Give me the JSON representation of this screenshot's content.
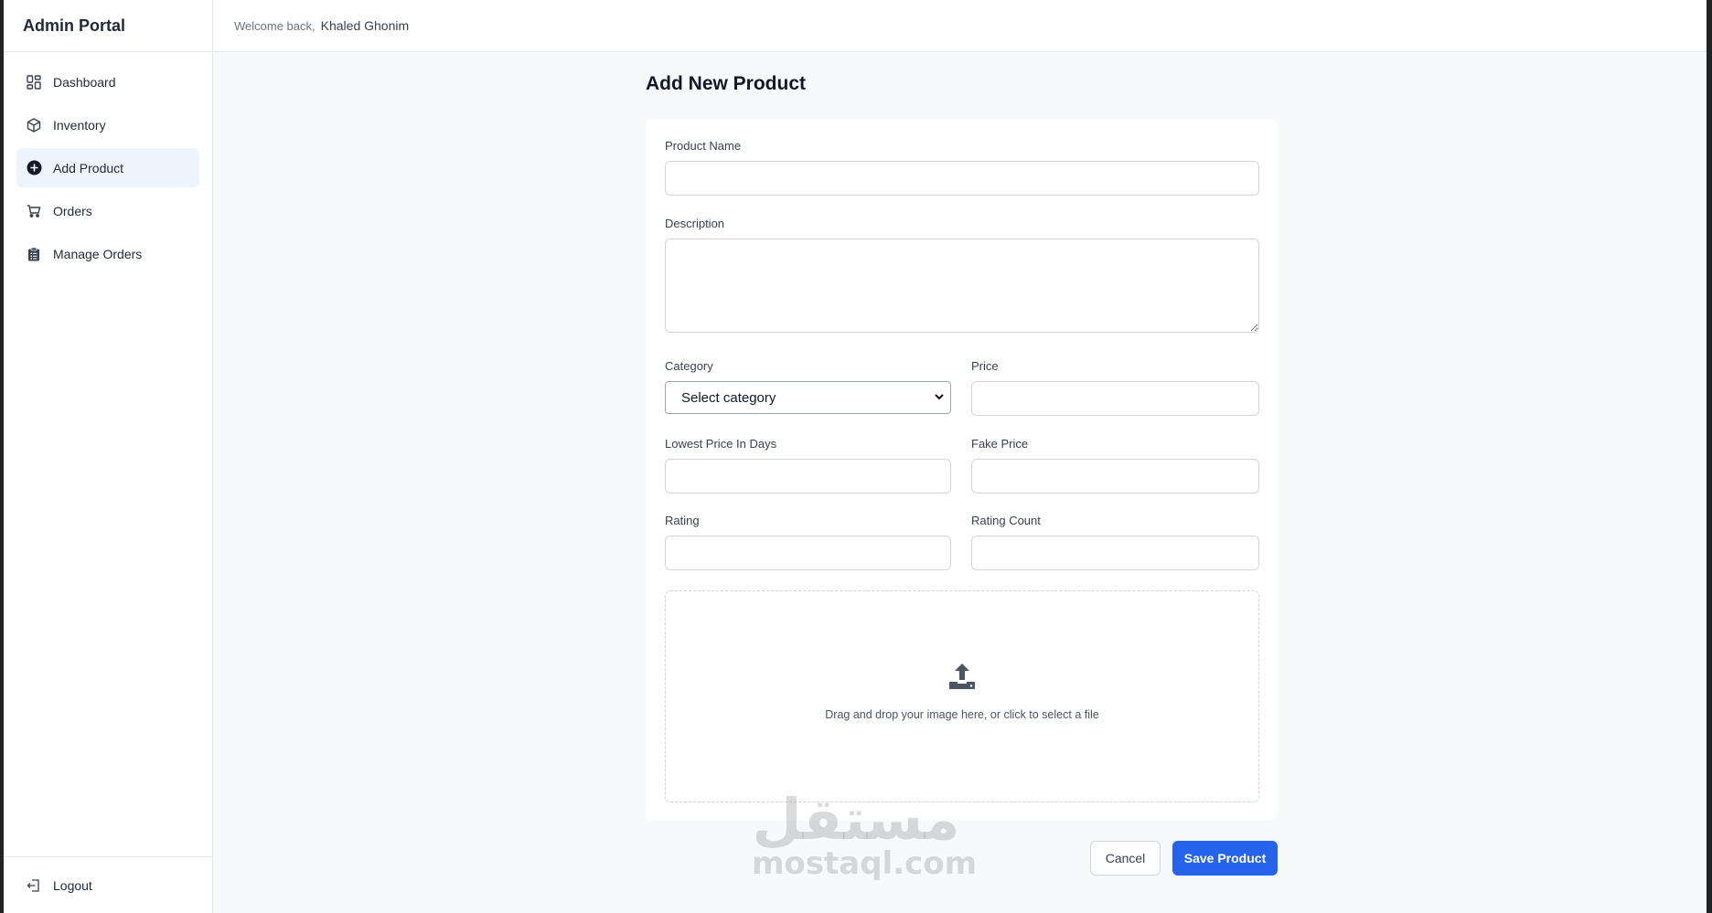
{
  "brand": "Admin Portal",
  "header": {
    "welcome": "Welcome back,",
    "username": "Khaled Ghonim"
  },
  "sidebar": {
    "items": [
      {
        "label": "Dashboard",
        "icon": "dashboard-icon",
        "active": false
      },
      {
        "label": "Inventory",
        "icon": "box-icon",
        "active": false
      },
      {
        "label": "Add Product",
        "icon": "plus-circle-icon",
        "active": true
      },
      {
        "label": "Orders",
        "icon": "cart-icon",
        "active": false
      },
      {
        "label": "Manage Orders",
        "icon": "clipboard-icon",
        "active": false
      }
    ],
    "logout": "Logout"
  },
  "page_title": "Add New Product",
  "form": {
    "product_name": {
      "label": "Product Name",
      "value": ""
    },
    "description": {
      "label": "Description",
      "value": ""
    },
    "category": {
      "label": "Category",
      "selected": "Select category"
    },
    "price": {
      "label": "Price",
      "value": ""
    },
    "lowest_price_days": {
      "label": "Lowest Price In Days",
      "value": ""
    },
    "fake_price": {
      "label": "Fake Price",
      "value": ""
    },
    "rating": {
      "label": "Rating",
      "value": ""
    },
    "rating_count": {
      "label": "Rating Count",
      "value": ""
    },
    "dropzone_text": "Drag and drop your image here, or click to select a file"
  },
  "actions": {
    "cancel": "Cancel",
    "save": "Save Product"
  },
  "watermark": {
    "arabic": "مستقل",
    "latin": "mostaql.com"
  },
  "colors": {
    "primary": "#2563eb",
    "active_nav_bg": "#eef4fc",
    "page_bg": "#f8f9fb"
  }
}
